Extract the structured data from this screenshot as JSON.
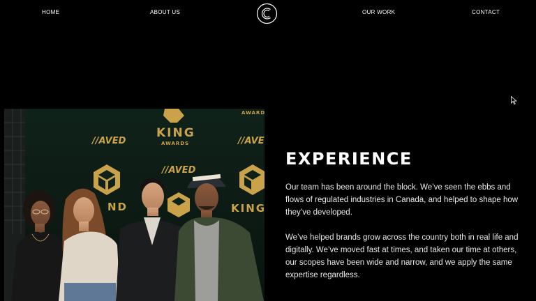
{
  "nav": {
    "home": "HOME",
    "about": "ABOUT US",
    "work": "OUR WORK",
    "contact": "CONTACT"
  },
  "photo": {
    "backdrop_brand": "KING",
    "backdrop_sub": "AWARDS",
    "backdrop_sponsor": "//AVED",
    "backdrop_top_right": "AWARDS",
    "backdrop_right_brand": "KING",
    "backdrop_left_bottom": "ND"
  },
  "experience": {
    "heading": "EXPERIENCE",
    "paragraph1": "Our team has been around the block. We’ve seen the ebbs and flows of regulated industries in Canada, and helped to shape how they’ve developed.",
    "paragraph2": "We’ve helped brands grow across the country both in real life and digitally. We’ve moved fast at times, and taken our time at others, our scopes have been wide and narrow, and we apply the same expertise regardless."
  },
  "colors": {
    "background": "#000000",
    "text": "#ffffff",
    "gold": "#c9a24a",
    "backdrop": "#0f1f18"
  }
}
